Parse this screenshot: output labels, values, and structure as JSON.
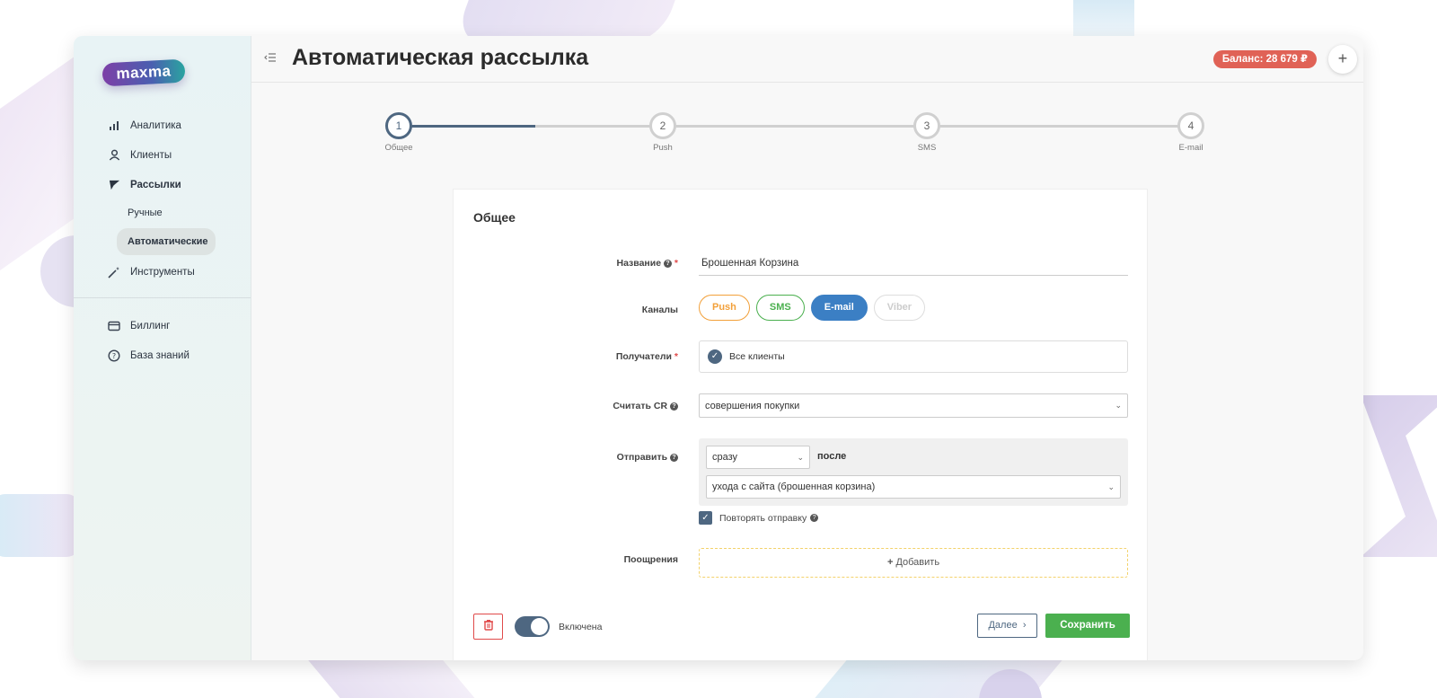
{
  "colors": {
    "accent": "#4e6781",
    "balance_badge": "#e06256",
    "push": "#f2a03a",
    "sms": "#4bb04f",
    "email": "#3b7fc4",
    "save": "#4bb04f",
    "danger": "#e04a4a"
  },
  "logo": "maxma",
  "sidebar": {
    "items": [
      {
        "label": "Аналитика",
        "icon": "bar-chart-icon"
      },
      {
        "label": "Клиенты",
        "icon": "user-icon"
      },
      {
        "label": "Рассылки",
        "icon": "send-icon"
      }
    ],
    "sub_items": [
      {
        "label": "Ручные",
        "active": false
      },
      {
        "label": "Автоматические",
        "active": true
      }
    ],
    "tools": {
      "label": "Инструменты",
      "icon": "magic-wand-icon"
    },
    "bottom_items": [
      {
        "label": "Биллинг",
        "icon": "card-icon"
      },
      {
        "label": "База знаний",
        "icon": "help-circle-icon"
      }
    ]
  },
  "header": {
    "title": "Автоматическая рассылка",
    "balance": "Баланс: 28 679 ₽",
    "plus": "+"
  },
  "stepper": {
    "current_step": 1,
    "steps": [
      {
        "num": "1",
        "label": "Общее"
      },
      {
        "num": "2",
        "label": "Push"
      },
      {
        "num": "3",
        "label": "SMS"
      },
      {
        "num": "4",
        "label": "E-mail"
      }
    ]
  },
  "form": {
    "section_title": "Общее",
    "name": {
      "label": "Название",
      "value": "Брошенная Корзина"
    },
    "channels": {
      "label": "Каналы",
      "options": [
        "Push",
        "SMS",
        "E-mail",
        "Viber"
      ],
      "selected": "E-mail"
    },
    "recipients": {
      "label": "Получатели",
      "value": "Все клиенты"
    },
    "count_cr": {
      "label": "Считать CR",
      "value": "совершения покупки"
    },
    "send": {
      "label": "Отправить",
      "when": "сразу",
      "after_label": "после",
      "event": "ухода с сайта (брошенная корзина)"
    },
    "repeat": {
      "label": "Повторять отправку",
      "checked": true
    },
    "rewards": {
      "label": "Поощрения",
      "add_label": "Добавить"
    }
  },
  "footer": {
    "toggle_label": "Включена",
    "toggle_on": true,
    "next_label": "Далее",
    "save_label": "Сохранить"
  }
}
